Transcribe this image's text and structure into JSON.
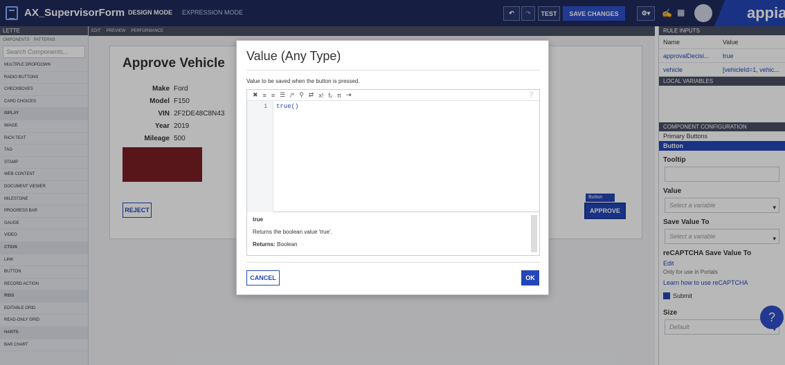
{
  "header": {
    "title": "AX_SupervisorForm",
    "design_mode": "DESIGN MODE",
    "expression_mode": "EXPRESSION MODE",
    "test": "TEST",
    "save_changes": "SAVE CHANGES",
    "brand": "appian"
  },
  "palette": {
    "title": "LETTE",
    "tab_components": "OMPONENTS",
    "tab_patterns": "PATTERNS",
    "search_placeholder": "Search Components...",
    "items": [
      {
        "label": "MULTIPLE DROPDOWN",
        "section": false
      },
      {
        "label": "RADIO BUTTONS",
        "section": false
      },
      {
        "label": "CHECKBOXES",
        "section": false
      },
      {
        "label": "CARD CHOICES",
        "section": false
      },
      {
        "label": "ISPLAY",
        "section": true
      },
      {
        "label": "IMAGE",
        "section": false
      },
      {
        "label": "RICH TEXT",
        "section": false
      },
      {
        "label": "TAG",
        "section": false
      },
      {
        "label": "STAMP",
        "section": false
      },
      {
        "label": "WEB CONTENT",
        "section": false
      },
      {
        "label": "DOCUMENT VIEWER",
        "section": false
      },
      {
        "label": "MILESTONE",
        "section": false
      },
      {
        "label": "PROGRESS BAR",
        "section": false
      },
      {
        "label": "GAUGE",
        "section": false
      },
      {
        "label": "VIDEO",
        "section": false
      },
      {
        "label": "CTION",
        "section": true
      },
      {
        "label": "LINK",
        "section": false
      },
      {
        "label": "BUTTON",
        "section": false
      },
      {
        "label": "RECORD ACTION",
        "section": false
      },
      {
        "label": "RIDS",
        "section": true
      },
      {
        "label": "EDITABLE GRID",
        "section": false
      },
      {
        "label": "READ-ONLY GRID",
        "section": false
      },
      {
        "label": "HARTS",
        "section": true
      },
      {
        "label": "BAR CHART",
        "section": false
      }
    ]
  },
  "editor_tabs": {
    "edit": "EDIT",
    "preview": "PREVIEW",
    "performance": "PERFORMANCE"
  },
  "form": {
    "heading": "Approve Vehicle",
    "fields": [
      {
        "label": "Make",
        "value": "Ford"
      },
      {
        "label": "Model",
        "value": "F150"
      },
      {
        "label": "VIN",
        "value": "2F2DE48C8N43"
      },
      {
        "label": "Year",
        "value": "2019"
      },
      {
        "label": "Mileage",
        "value": "500"
      }
    ],
    "reject": "REJECT",
    "approve": "APPROVE",
    "button_tag": "Button"
  },
  "right": {
    "rule_inputs": "RULE INPUTS",
    "col_name": "Name",
    "col_value": "Value",
    "rows": [
      {
        "name": "approvalDecisi...",
        "value": "true"
      },
      {
        "name": "vehicle",
        "value": "[vehicleId=1, vehic..."
      }
    ],
    "local_variables": "LOCAL VARIABLES",
    "component_config": "COMPONENT CONFIGURATION",
    "primary_buttons": "Primary Buttons",
    "button": "Button",
    "tooltip": "Tooltip",
    "value": "Value",
    "value_placeholder": "Select a variable",
    "save_value_to": "Save Value To",
    "save_placeholder": "Select a variable",
    "recaptcha": "reCAPTCHA Save Value To",
    "edit": "Edit",
    "portals_note": "Only for use in Portals",
    "learn": "Learn how to use reCAPTCHA",
    "submit": "Submit",
    "size": "Size",
    "size_default": "Default"
  },
  "modal": {
    "title": "Value (Any Type)",
    "description": "Value to be saved when the button is pressed.",
    "line_number": "1",
    "code": "true()",
    "help_title": "true",
    "help_desc": "Returns the boolean value 'true'.",
    "returns_label": "Returns:",
    "returns_value": "Boolean",
    "cancel": "CANCEL",
    "ok": "OK"
  }
}
